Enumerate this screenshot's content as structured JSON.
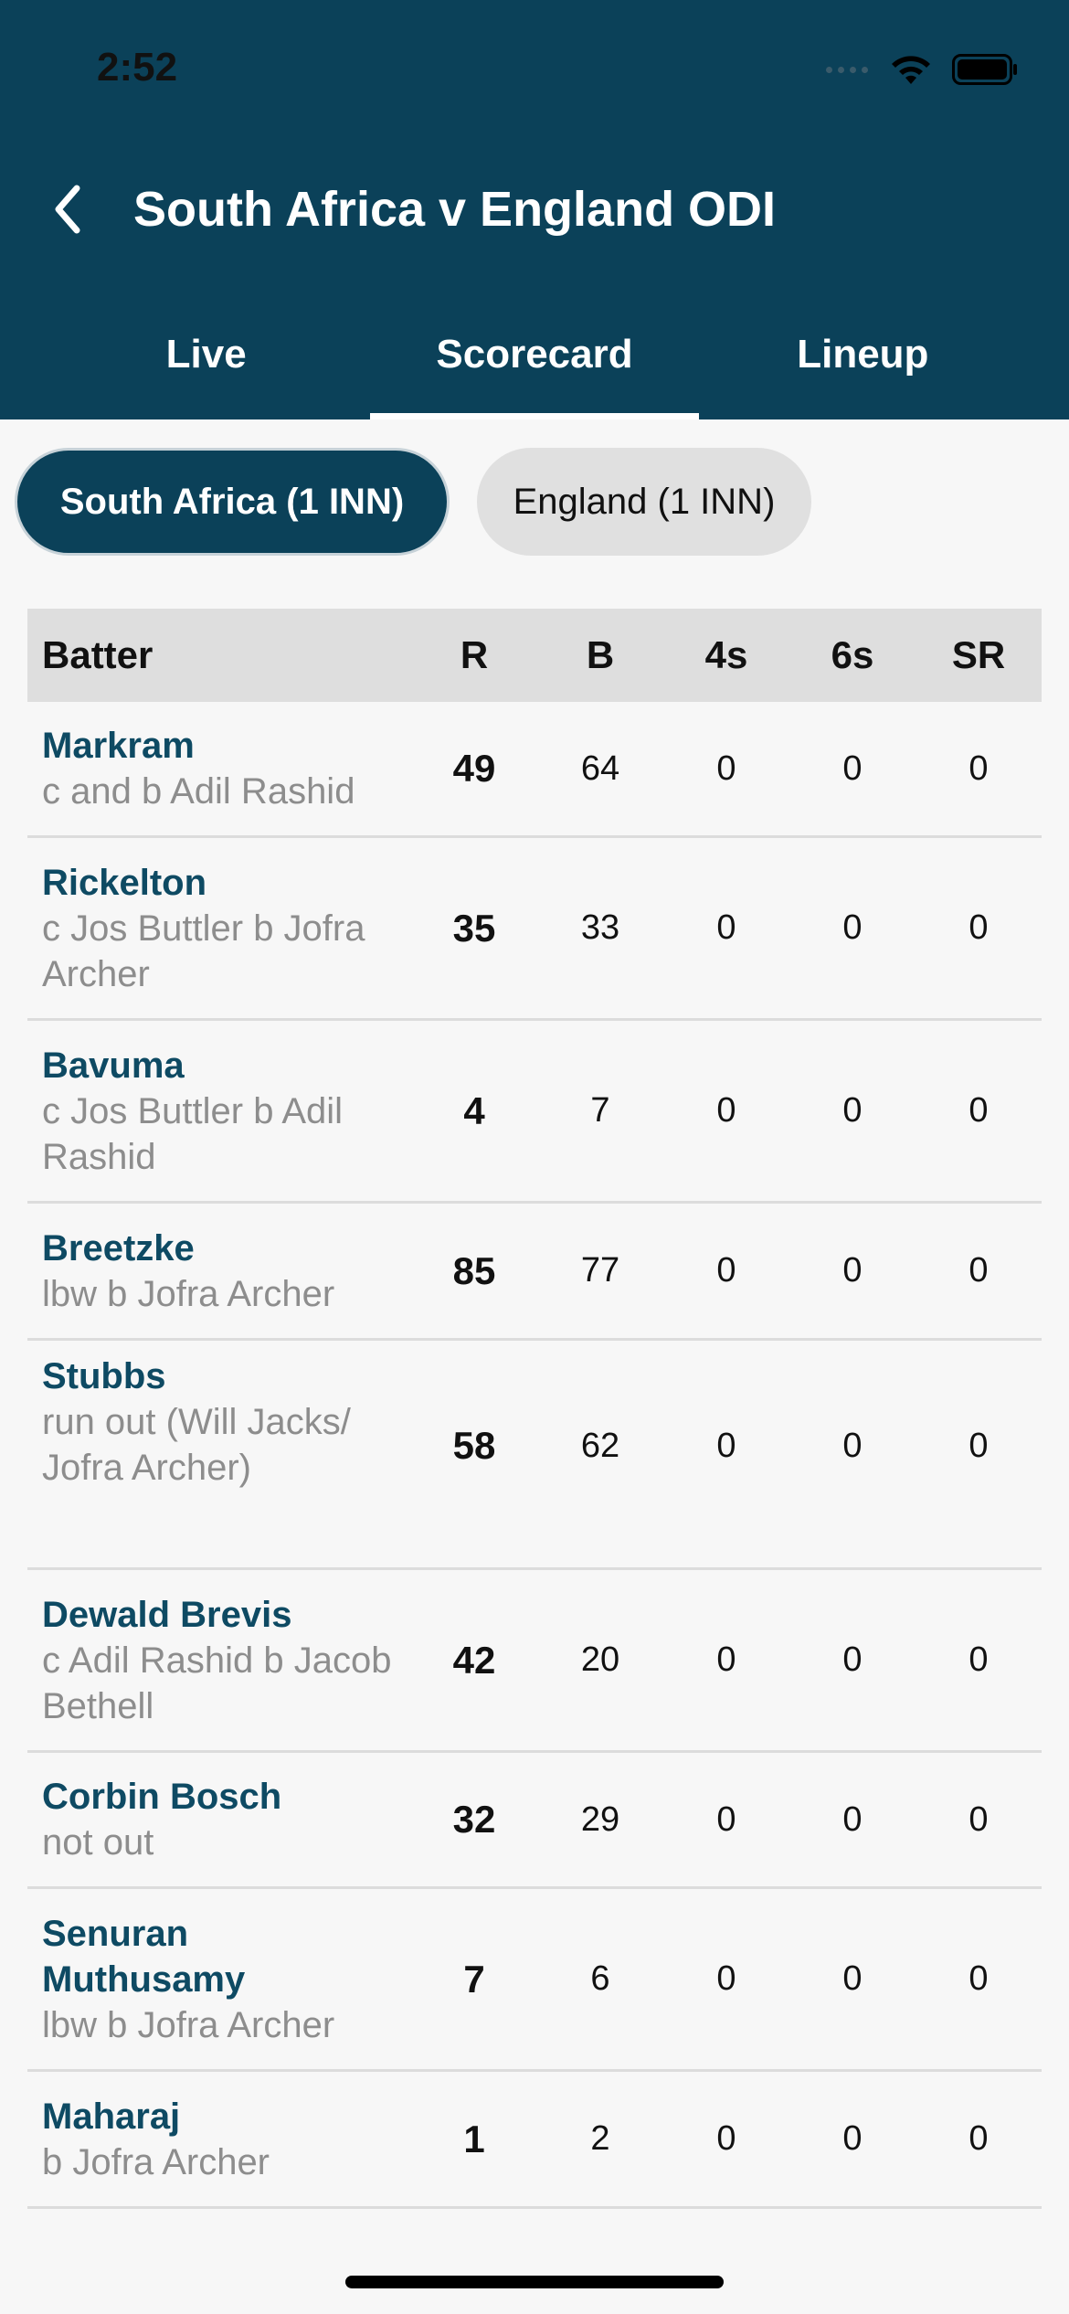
{
  "status_bar": {
    "time": "2:52"
  },
  "header": {
    "title": "South Africa v England ODI",
    "tabs": [
      {
        "label": "Live",
        "active": false
      },
      {
        "label": "Scorecard",
        "active": true
      },
      {
        "label": "Lineup",
        "active": false
      }
    ]
  },
  "innings": {
    "selected": "South Africa (1 INN)",
    "other": "England (1 INN)"
  },
  "table": {
    "headers": [
      "Batter",
      "R",
      "B",
      "4s",
      "6s",
      "SR"
    ],
    "rows": [
      {
        "name": "Markram",
        "dismissal": "c and b Adil Rashid",
        "r": "49",
        "b": "64",
        "fours": "0",
        "sixes": "0",
        "sr": "0"
      },
      {
        "name": "Rickelton",
        "dismissal": "c Jos Buttler b Jofra Archer",
        "r": "35",
        "b": "33",
        "fours": "0",
        "sixes": "0",
        "sr": "0"
      },
      {
        "name": "Bavuma",
        "dismissal": "c Jos Buttler b Adil Rashid",
        "r": "4",
        "b": "7",
        "fours": "0",
        "sixes": "0",
        "sr": "0"
      },
      {
        "name": "Breetzke",
        "dismissal": "lbw b Jofra Archer",
        "r": "85",
        "b": "77",
        "fours": "0",
        "sixes": "0",
        "sr": "0"
      },
      {
        "name": "Stubbs",
        "dismissal": "run out (Will Jacks/ Jofra Archer)",
        "r": "58",
        "b": "62",
        "fours": "0",
        "sixes": "0",
        "sr": "0"
      },
      {
        "name": "Dewald Brevis",
        "dismissal": "c Adil Rashid b Jacob Bethell",
        "r": "42",
        "b": "20",
        "fours": "0",
        "sixes": "0",
        "sr": "0"
      },
      {
        "name": "Corbin Bosch",
        "dismissal": "not out",
        "r": "32",
        "b": "29",
        "fours": "0",
        "sixes": "0",
        "sr": "0"
      },
      {
        "name": "Senuran Muthusamy",
        "dismissal": "lbw b Jofra Archer",
        "r": "7",
        "b": "6",
        "fours": "0",
        "sixes": "0",
        "sr": "0"
      },
      {
        "name": "Maharaj",
        "dismissal": "b Jofra Archer",
        "r": "1",
        "b": "2",
        "fours": "0",
        "sixes": "0",
        "sr": "0"
      }
    ]
  },
  "colors": {
    "header_bg": "#0b4159",
    "name_text": "#0e4a63",
    "dismissal_text": "#8d8d8d"
  },
  "icons": {
    "back": "chevron-left-icon",
    "wifi": "wifi-icon",
    "battery": "battery-icon",
    "signal": "signal-icon"
  }
}
